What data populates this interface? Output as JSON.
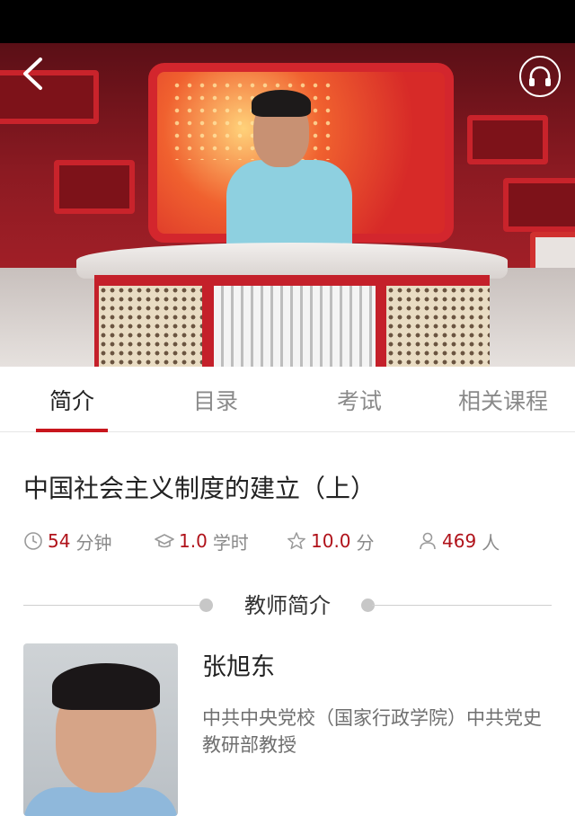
{
  "video": {
    "back_icon": "chevron-left-icon",
    "audio_icon": "headphones-icon"
  },
  "tabs": [
    {
      "label": "简介",
      "active": true
    },
    {
      "label": "目录",
      "active": false
    },
    {
      "label": "考试",
      "active": false
    },
    {
      "label": "相关课程",
      "active": false
    }
  ],
  "course": {
    "title": "中国社会主义制度的建立（上）",
    "stats": {
      "duration": {
        "icon": "clock-icon",
        "value": "54",
        "unit": "分钟"
      },
      "credit": {
        "icon": "graduation-cap-icon",
        "value": "1.0",
        "unit": "学时"
      },
      "rating": {
        "icon": "star-icon",
        "value": "10.0",
        "unit": "分"
      },
      "learners": {
        "icon": "user-icon",
        "value": "469",
        "unit": "人"
      }
    }
  },
  "teacher_section": {
    "title": "教师简介",
    "name": "张旭东",
    "description": "中共中央党校（国家行政学院）中共党史教研部教授"
  },
  "colors": {
    "accent": "#c8161d",
    "value_red": "#b0121a",
    "muted": "#8a8a8a"
  }
}
